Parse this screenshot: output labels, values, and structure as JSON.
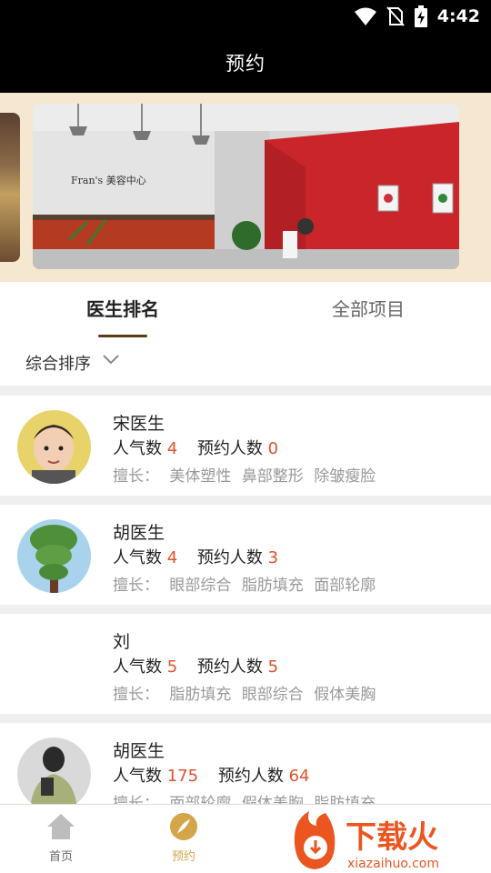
{
  "status_bar": {
    "time": "4:42"
  },
  "header": {
    "title": "预约"
  },
  "tabs": [
    {
      "label": "医生排名",
      "active": true
    },
    {
      "label": "全部项目",
      "active": false
    }
  ],
  "sort": {
    "label": "综合排序"
  },
  "banner": {
    "sign_text": "Fran's 美容中心"
  },
  "stats_labels": {
    "popularity": "人气数",
    "appointments": "预约人数",
    "specialty": "擅长："
  },
  "doctors": [
    {
      "name": "宋医生",
      "popularity": "4",
      "appointments": "0",
      "specialties": [
        "美体塑性",
        "鼻部整形",
        "除皱瘦脸"
      ]
    },
    {
      "name": "胡医生",
      "popularity": "4",
      "appointments": "3",
      "specialties": [
        "眼部综合",
        "脂肪填充",
        "面部轮廓"
      ]
    },
    {
      "name": "刘",
      "popularity": "5",
      "appointments": "5",
      "specialties": [
        "脂肪填充",
        "眼部综合",
        "假体美胸"
      ]
    },
    {
      "name": "胡医生",
      "popularity": "175",
      "appointments": "64",
      "specialties": [
        "面部轮廓",
        "假体美胸",
        "脂肪填充"
      ]
    }
  ],
  "bottom_nav": [
    {
      "label": "首页",
      "active": false
    },
    {
      "label": "预约",
      "active": true
    }
  ],
  "watermark": {
    "text": "下载火",
    "domain": "xiazaihuo.com"
  },
  "colors": {
    "accent_orange": "#e0522a",
    "active_gold": "#d4a64a",
    "banner_bg": "#f6e7d1",
    "tab_underline": "#5a3a18"
  }
}
